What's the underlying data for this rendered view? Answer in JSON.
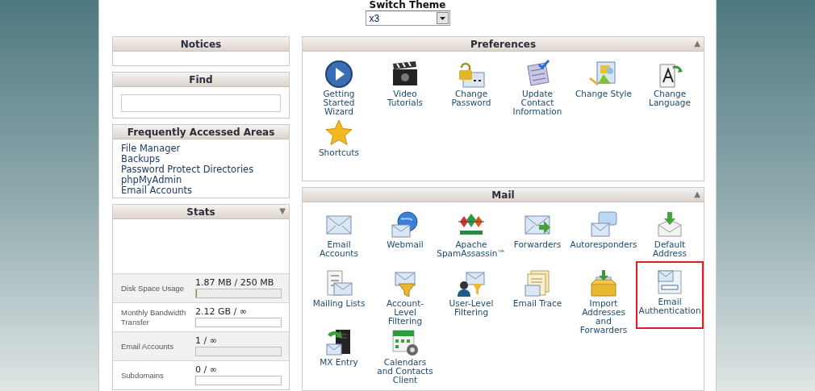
{
  "theme_switch": {
    "label": "Switch Theme",
    "value": "x3"
  },
  "left_panels": [
    {
      "title": "Notices",
      "kind": "empty"
    },
    {
      "title": "Find",
      "kind": "search"
    },
    {
      "title": "Frequently Accessed Areas",
      "kind": "links",
      "links": [
        "File Manager",
        "Backups",
        "Password Protect Directories",
        "phpMyAdmin",
        "Email Accounts"
      ]
    },
    {
      "title": "Stats",
      "kind": "stats",
      "arrow": "▼",
      "rows": [
        {
          "label": "Disk Space Usage",
          "value": "1.87 MB / 250 MB",
          "level": 0.01
        },
        {
          "label": "Monthly Bandwidth Transfer",
          "value": "2.12 GB / ∞"
        },
        {
          "label": "Email Accounts",
          "value": "1 / ∞"
        },
        {
          "label": "Subdomains",
          "value": "0 / ∞"
        }
      ]
    }
  ],
  "sections": [
    {
      "title": "Preferences",
      "arrow": "▲",
      "items": [
        {
          "label": "Getting Started Wizard",
          "highlighted": false
        },
        {
          "label": "Video Tutorials",
          "highlighted": false
        },
        {
          "label": "Change Password",
          "highlighted": false
        },
        {
          "label": "Update Contact Information",
          "highlighted": false
        },
        {
          "label": "Change Style",
          "highlighted": false
        },
        {
          "label": "Change Language",
          "highlighted": false
        },
        {
          "label": "Shortcuts",
          "highlighted": false
        }
      ]
    },
    {
      "title": "Mail",
      "arrow": "▲",
      "items": [
        {
          "label": "Email Accounts",
          "highlighted": false
        },
        {
          "label": "Webmail",
          "highlighted": false
        },
        {
          "label": "Apache SpamAssassin™",
          "highlighted": false
        },
        {
          "label": "Forwarders",
          "highlighted": false
        },
        {
          "label": "Autoresponders",
          "highlighted": false
        },
        {
          "label": "Default Address",
          "highlighted": false
        },
        {
          "label": "Mailing Lists",
          "highlighted": false
        },
        {
          "label": "Account-Level Filtering",
          "highlighted": false
        },
        {
          "label": "User-Level Filtering",
          "highlighted": false
        },
        {
          "label": "Email Trace",
          "highlighted": false
        },
        {
          "label": "Import Addresses and Forwarders",
          "highlighted": false
        },
        {
          "label": "Email Authentication",
          "highlighted": true
        },
        {
          "label": "MX Entry",
          "highlighted": false
        },
        {
          "label": "Calendars and Contacts Client",
          "highlighted": false
        }
      ]
    }
  ]
}
